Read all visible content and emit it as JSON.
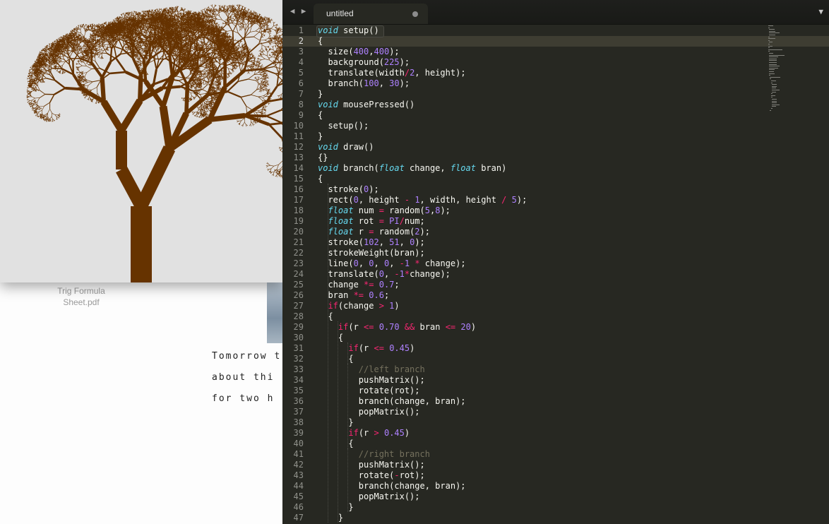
{
  "desktop": {
    "file_icon_label": "Trig Formula Sheet.pdf",
    "file_icon_label_lines": [
      "Trig Formula",
      "Sheet.pdf"
    ],
    "note_lines": [
      "Tomorrow t",
      "about thi",
      "for two h"
    ]
  },
  "sketch": {
    "background": "#e1e1e1",
    "trunk_color": "#663300",
    "canvas_size": 400
  },
  "editor": {
    "tab_title": "untitled",
    "back_arrow": "◀",
    "forward_arrow": "▶",
    "tab_menu_icon": "▼",
    "active_line": 2,
    "colors": {
      "background": "#272822",
      "keyword": "#66d9ef",
      "number": "#ae81ff",
      "operator": "#f92672",
      "comment": "#75715e",
      "text": "#f8f8f2"
    },
    "lines": [
      [
        [
          "kw",
          "void"
        ],
        [
          "t",
          " setup()"
        ]
      ],
      [
        [
          "t",
          "{"
        ]
      ],
      [
        [
          "t",
          "  size("
        ],
        [
          "num",
          "400"
        ],
        [
          "t",
          ","
        ],
        [
          "num",
          "400"
        ],
        [
          "t",
          ");"
        ]
      ],
      [
        [
          "t",
          "  background("
        ],
        [
          "num",
          "225"
        ],
        [
          "t",
          ");"
        ]
      ],
      [
        [
          "t",
          "  translate(width"
        ],
        [
          "op",
          "/"
        ],
        [
          "num",
          "2"
        ],
        [
          "t",
          ", height);"
        ]
      ],
      [
        [
          "t",
          "  branch("
        ],
        [
          "num",
          "100"
        ],
        [
          "t",
          ", "
        ],
        [
          "num",
          "30"
        ],
        [
          "t",
          ");"
        ]
      ],
      [
        [
          "t",
          "}"
        ]
      ],
      [
        [
          "kw",
          "void"
        ],
        [
          "t",
          " mousePressed()"
        ]
      ],
      [
        [
          "t",
          "{"
        ]
      ],
      [
        [
          "t",
          "  setup();"
        ]
      ],
      [
        [
          "t",
          "}"
        ]
      ],
      [
        [
          "kw",
          "void"
        ],
        [
          "t",
          " draw()"
        ]
      ],
      [
        [
          "t",
          "{}"
        ]
      ],
      [
        [
          "kw",
          "void"
        ],
        [
          "t",
          " branch("
        ],
        [
          "kw",
          "float"
        ],
        [
          "t",
          " change, "
        ],
        [
          "kw",
          "float"
        ],
        [
          "t",
          " bran)"
        ]
      ],
      [
        [
          "t",
          "{"
        ]
      ],
      [
        [
          "t",
          "  stroke("
        ],
        [
          "num",
          "0"
        ],
        [
          "t",
          ");"
        ]
      ],
      [
        [
          "t",
          "  rect("
        ],
        [
          "num",
          "0"
        ],
        [
          "t",
          ", height "
        ],
        [
          "op",
          "-"
        ],
        [
          "t",
          " "
        ],
        [
          "num",
          "1"
        ],
        [
          "t",
          ", width, height "
        ],
        [
          "op",
          "/"
        ],
        [
          "t",
          " "
        ],
        [
          "num",
          "5"
        ],
        [
          "t",
          ");"
        ]
      ],
      [
        [
          "t",
          "  "
        ],
        [
          "kw",
          "float"
        ],
        [
          "t",
          " num "
        ],
        [
          "op",
          "="
        ],
        [
          "t",
          " random("
        ],
        [
          "num",
          "5"
        ],
        [
          "t",
          ","
        ],
        [
          "num",
          "8"
        ],
        [
          "t",
          ");"
        ]
      ],
      [
        [
          "t",
          "  "
        ],
        [
          "kw",
          "float"
        ],
        [
          "t",
          " rot "
        ],
        [
          "op",
          "="
        ],
        [
          "t",
          " "
        ],
        [
          "num",
          "PI"
        ],
        [
          "op",
          "/"
        ],
        [
          "t",
          "num;"
        ]
      ],
      [
        [
          "t",
          "  "
        ],
        [
          "kw",
          "float"
        ],
        [
          "t",
          " r "
        ],
        [
          "op",
          "="
        ],
        [
          "t",
          " random("
        ],
        [
          "num",
          "2"
        ],
        [
          "t",
          ");"
        ]
      ],
      [
        [
          "t",
          "  stroke("
        ],
        [
          "num",
          "102"
        ],
        [
          "t",
          ", "
        ],
        [
          "num",
          "51"
        ],
        [
          "t",
          ", "
        ],
        [
          "num",
          "0"
        ],
        [
          "t",
          ");"
        ]
      ],
      [
        [
          "t",
          "  strokeWeight(bran);"
        ]
      ],
      [
        [
          "t",
          "  line("
        ],
        [
          "num",
          "0"
        ],
        [
          "t",
          ", "
        ],
        [
          "num",
          "0"
        ],
        [
          "t",
          ", "
        ],
        [
          "num",
          "0"
        ],
        [
          "t",
          ", "
        ],
        [
          "op",
          "-"
        ],
        [
          "num",
          "1"
        ],
        [
          "t",
          " "
        ],
        [
          "op",
          "*"
        ],
        [
          "t",
          " change);"
        ]
      ],
      [
        [
          "t",
          "  translate("
        ],
        [
          "num",
          "0"
        ],
        [
          "t",
          ", "
        ],
        [
          "op",
          "-"
        ],
        [
          "num",
          "1"
        ],
        [
          "op",
          "*"
        ],
        [
          "t",
          "change);"
        ]
      ],
      [
        [
          "t",
          "  change "
        ],
        [
          "op",
          "*="
        ],
        [
          "t",
          " "
        ],
        [
          "num",
          "0.7"
        ],
        [
          "t",
          ";"
        ]
      ],
      [
        [
          "t",
          "  bran "
        ],
        [
          "op",
          "*="
        ],
        [
          "t",
          " "
        ],
        [
          "num",
          "0.6"
        ],
        [
          "t",
          ";"
        ]
      ],
      [
        [
          "t",
          "  "
        ],
        [
          "op",
          "if"
        ],
        [
          "t",
          "(change "
        ],
        [
          "op",
          ">"
        ],
        [
          "t",
          " "
        ],
        [
          "num",
          "1"
        ],
        [
          "t",
          ")"
        ]
      ],
      [
        [
          "t",
          "  {"
        ]
      ],
      [
        [
          "t",
          "    "
        ],
        [
          "op",
          "if"
        ],
        [
          "t",
          "(r "
        ],
        [
          "op",
          "<="
        ],
        [
          "t",
          " "
        ],
        [
          "num",
          "0.70"
        ],
        [
          "t",
          " "
        ],
        [
          "op",
          "&&"
        ],
        [
          "t",
          " bran "
        ],
        [
          "op",
          "<="
        ],
        [
          "t",
          " "
        ],
        [
          "num",
          "20"
        ],
        [
          "t",
          ")"
        ]
      ],
      [
        [
          "t",
          "    {"
        ]
      ],
      [
        [
          "t",
          "      "
        ],
        [
          "op",
          "if"
        ],
        [
          "t",
          "(r "
        ],
        [
          "op",
          "<="
        ],
        [
          "t",
          " "
        ],
        [
          "num",
          "0.45"
        ],
        [
          "t",
          ")"
        ]
      ],
      [
        [
          "t",
          "      {"
        ]
      ],
      [
        [
          "t",
          "        "
        ],
        [
          "cm",
          "//left branch"
        ]
      ],
      [
        [
          "t",
          "        pushMatrix();"
        ]
      ],
      [
        [
          "t",
          "        rotate(rot);"
        ]
      ],
      [
        [
          "t",
          "        branch(change, bran);"
        ]
      ],
      [
        [
          "t",
          "        popMatrix();"
        ]
      ],
      [
        [
          "t",
          "      }"
        ]
      ],
      [
        [
          "t",
          "      "
        ],
        [
          "op",
          "if"
        ],
        [
          "t",
          "(r "
        ],
        [
          "op",
          ">"
        ],
        [
          "t",
          " "
        ],
        [
          "num",
          "0.45"
        ],
        [
          "t",
          ")"
        ]
      ],
      [
        [
          "t",
          "      {"
        ]
      ],
      [
        [
          "t",
          "        "
        ],
        [
          "cm",
          "//right branch"
        ]
      ],
      [
        [
          "t",
          "        pushMatrix();"
        ]
      ],
      [
        [
          "t",
          "        rotate("
        ],
        [
          "op",
          "-"
        ],
        [
          "t",
          "rot);"
        ]
      ],
      [
        [
          "t",
          "        branch(change, bran);"
        ]
      ],
      [
        [
          "t",
          "        popMatrix();"
        ]
      ],
      [
        [
          "t",
          "      }"
        ]
      ],
      [
        [
          "t",
          "    }"
        ]
      ]
    ]
  }
}
